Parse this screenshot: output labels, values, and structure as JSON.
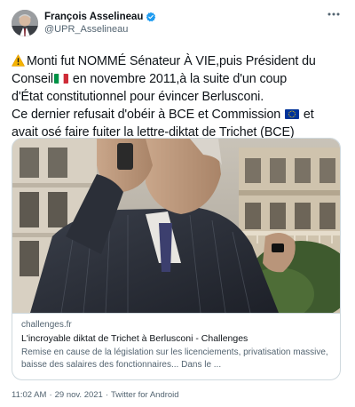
{
  "author": {
    "display_name": "François Asselineau",
    "handle": "@UPR_Asselineau",
    "avatar_icon": "avatar-photo",
    "verified_icon": "verified-badge-icon",
    "verified_color": "#1d9bf0"
  },
  "tweet": {
    "lines": [
      "Monti fut NOMMÉ Sénateur À VIE,puis Président du",
      "Conseil",
      " en novembre 2011,à la suite d'un coup",
      "d'État constitutionnel pour évincer Berlusconi.",
      "Ce dernier refusait d'obéir à BCE et Commission",
      " et",
      "avait osé faire fuiter la lettre-diktat de Trichet (BCE)"
    ],
    "warning_icon": "warning-emoji-icon",
    "italy_flag_icon": "italy-flag-icon",
    "eu_flag_icon": "eu-flag-icon"
  },
  "card": {
    "domain": "challenges.fr",
    "title": "L'incroyable diktat de Trichet à Berlusconi - Challenges",
    "description_lines": [
      "Remise en cause de la législation sur les licenciements, privatisation massive,",
      "baisse des salaires des fonctionnaires... Dans le ..."
    ]
  },
  "meta": {
    "time": "11:02 AM",
    "date": "29 nov. 2021",
    "source": "Twitter for Android",
    "separator": "·"
  },
  "colors": {
    "text": "#0f1419",
    "secondary": "#536471",
    "border": "#cfd9de"
  }
}
